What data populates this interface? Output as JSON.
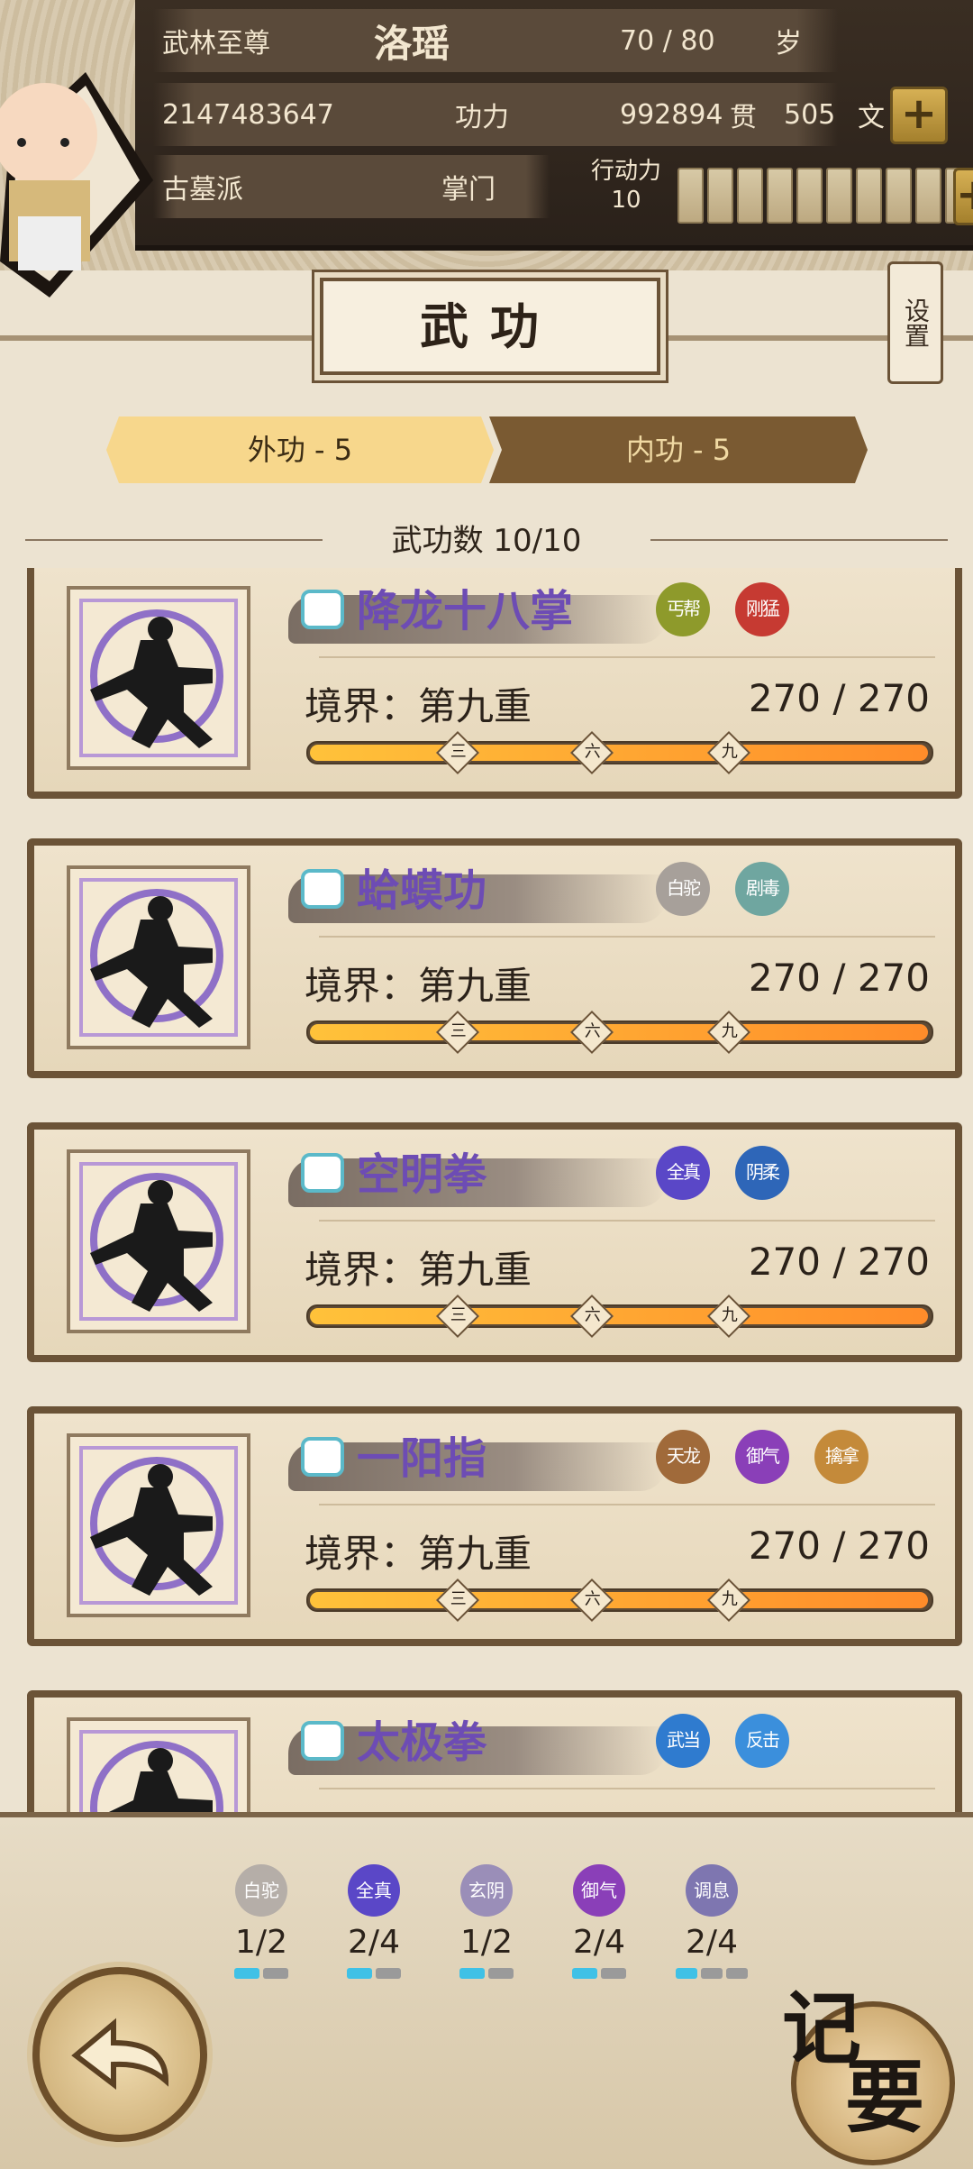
{
  "header": {
    "title_label": "武林至尊",
    "player_name": "洛瑶",
    "age": "70 / 80",
    "age_unit": "岁",
    "power_value": "2147483647",
    "power_label": "功力",
    "money_guan": "992894",
    "guan_label": "贯",
    "money_wen": "505",
    "wen_label": "文",
    "sect": "古墓派",
    "rank": "掌门",
    "action_label": "行动力",
    "action_value": "10"
  },
  "page_title": "武功",
  "settings_label": "设置",
  "tabs": [
    {
      "label": "外功 - 5",
      "active": true
    },
    {
      "label": "内功 - 5",
      "active": false
    }
  ],
  "skill_count_label": "武功数 10/10",
  "skills": [
    {
      "name": "降龙十八掌",
      "realm": "境界：第九重",
      "progress": "270 / 270",
      "badges": [
        {
          "text": "丐帮",
          "color": "#8e9a2b"
        },
        {
          "text": "刚猛",
          "color": "#c63a32"
        }
      ]
    },
    {
      "name": "蛤蟆功",
      "realm": "境界：第九重",
      "progress": "270 / 270",
      "badges": [
        {
          "text": "白驼",
          "color": "#a7a09a"
        },
        {
          "text": "剧毒",
          "color": "#6fa6a0"
        }
      ]
    },
    {
      "name": "空明拳",
      "realm": "境界：第九重",
      "progress": "270 / 270",
      "badges": [
        {
          "text": "全真",
          "color": "#5a47c7"
        },
        {
          "text": "阴柔",
          "color": "#2e66b8"
        }
      ]
    },
    {
      "name": "一阳指",
      "realm": "境界：第九重",
      "progress": "270 / 270",
      "badges": [
        {
          "text": "天龙",
          "color": "#a06a3a"
        },
        {
          "text": "御气",
          "color": "#8a3fb8"
        },
        {
          "text": "擒拿",
          "color": "#c48a3a"
        }
      ]
    },
    {
      "name": "太极拳",
      "realm": "",
      "progress": "",
      "badges": [
        {
          "text": "武当",
          "color": "#2f7bcf"
        },
        {
          "text": "反击",
          "color": "#3b8fdc"
        }
      ]
    }
  ],
  "markers": [
    "三",
    "六",
    "九"
  ],
  "bottom_stats": [
    {
      "label": "白驼",
      "color": "#b5aea8",
      "value": "1/2",
      "filled": 1,
      "total": 2
    },
    {
      "label": "全真",
      "color": "#5a47c7",
      "value": "2/4",
      "filled": 1,
      "total": 2
    },
    {
      "label": "玄阴",
      "color": "#9a8eb8",
      "value": "1/2",
      "filled": 1,
      "total": 2
    },
    {
      "label": "御气",
      "color": "#8a3fb8",
      "value": "2/4",
      "filled": 1,
      "total": 2
    },
    {
      "label": "调息",
      "color": "#7e76b0",
      "value": "2/4",
      "filled": 1,
      "total": 3
    }
  ],
  "summary_label": {
    "line1": "记",
    "line2": "要"
  },
  "icons": {
    "back": "back-arrow-icon",
    "plus": "plus-icon",
    "fist": "fist-icon"
  }
}
